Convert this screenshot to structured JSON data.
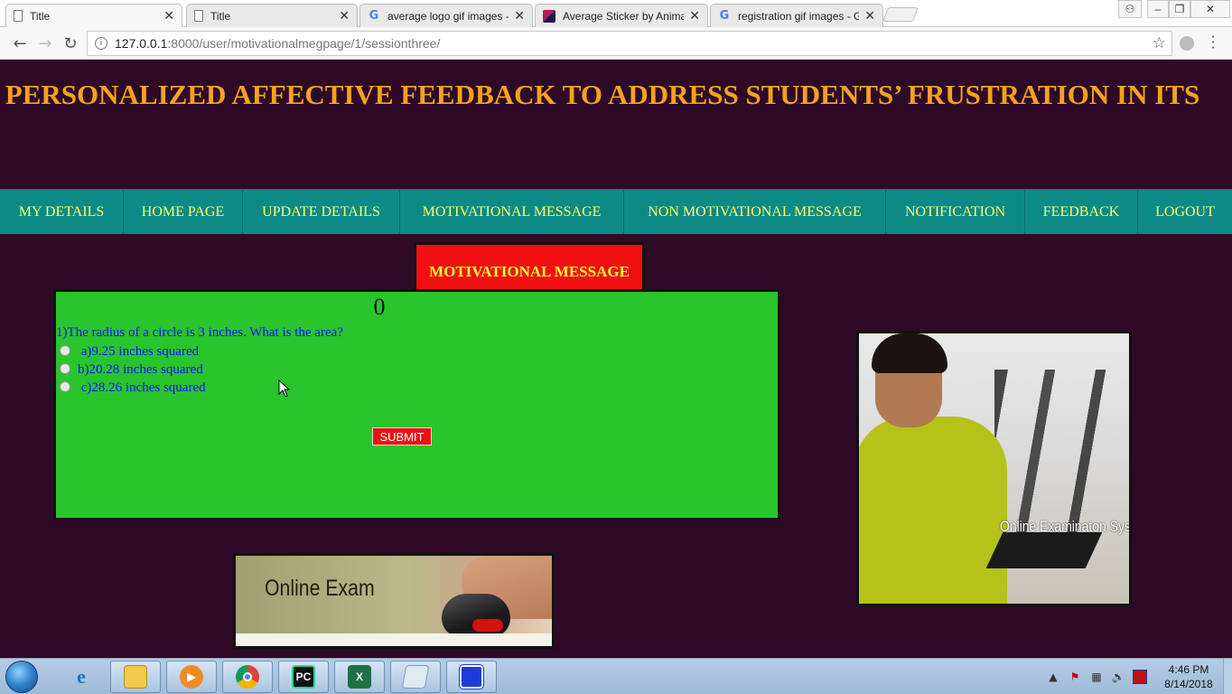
{
  "browser": {
    "tabs": [
      {
        "title": "Title",
        "icon": "document-icon",
        "active": true
      },
      {
        "title": "Title",
        "icon": "document-icon",
        "active": false
      },
      {
        "title": "average logo gif images -",
        "icon": "google-icon",
        "active": false
      },
      {
        "title": "Average Sticker by Anima",
        "icon": "sticker-icon",
        "active": false
      },
      {
        "title": "registration gif images - G",
        "icon": "google-icon",
        "active": false
      }
    ],
    "tab_close": "✕",
    "address": {
      "host": "127.0.0.1",
      "path": ":8000/user/motivationalmegpage/1/sessionthree/"
    },
    "window_controls": {
      "user": "⚇",
      "minimize": "–",
      "restore": "❐",
      "close": "✕"
    }
  },
  "page": {
    "title": "PERSONALIZED AFFECTIVE FEEDBACK TO ADDRESS STUDENTS’ FRUSTRATION IN ITS",
    "nav": [
      {
        "label": "MY DETAILS"
      },
      {
        "label": "HOME PAGE"
      },
      {
        "label": "UPDATE DETAILS"
      },
      {
        "label": "MOTIVATIONAL MESSAGE"
      },
      {
        "label": "NON MOTIVATIONAL MESSAGE"
      },
      {
        "label": "NOTIFICATION"
      },
      {
        "label": "FEEDBACK"
      },
      {
        "label": "LOGOUT"
      }
    ],
    "section_header": "MOTIVATIONAL MESSAGE",
    "quiz": {
      "score": "0",
      "question": "1)The radius of a circle is 3 inches. What is the area?",
      "options": [
        {
          "label": " a)9.25 inches squared",
          "selected": false
        },
        {
          "label": "b)20.28 inches squared",
          "selected": false
        },
        {
          "label": " c)28.26 inches squared",
          "selected": false
        }
      ],
      "submit_label": "SUBMIT"
    },
    "banner_text": "Online Exam",
    "photo_caption": "Online Examinaton System",
    "colors": {
      "background": "#2e0a27",
      "title": "#f7a21b",
      "nav_bg": "#0c8a86",
      "nav_text": "#ffff6a",
      "header_bg": "#f01010",
      "quiz_bg": "#2ac42c",
      "quiz_text": "#1010ff"
    }
  },
  "taskbar": {
    "apps": [
      {
        "name": "internet-explorer"
      },
      {
        "name": "file-explorer"
      },
      {
        "name": "media-player"
      },
      {
        "name": "chrome"
      },
      {
        "name": "pycharm"
      },
      {
        "name": "excel"
      },
      {
        "name": "notepad"
      },
      {
        "name": "snipping-tool"
      }
    ],
    "pycharm_label": "PC",
    "excel_label": "X",
    "clock_time": "4:46 PM",
    "clock_date": "8/14/2018"
  }
}
